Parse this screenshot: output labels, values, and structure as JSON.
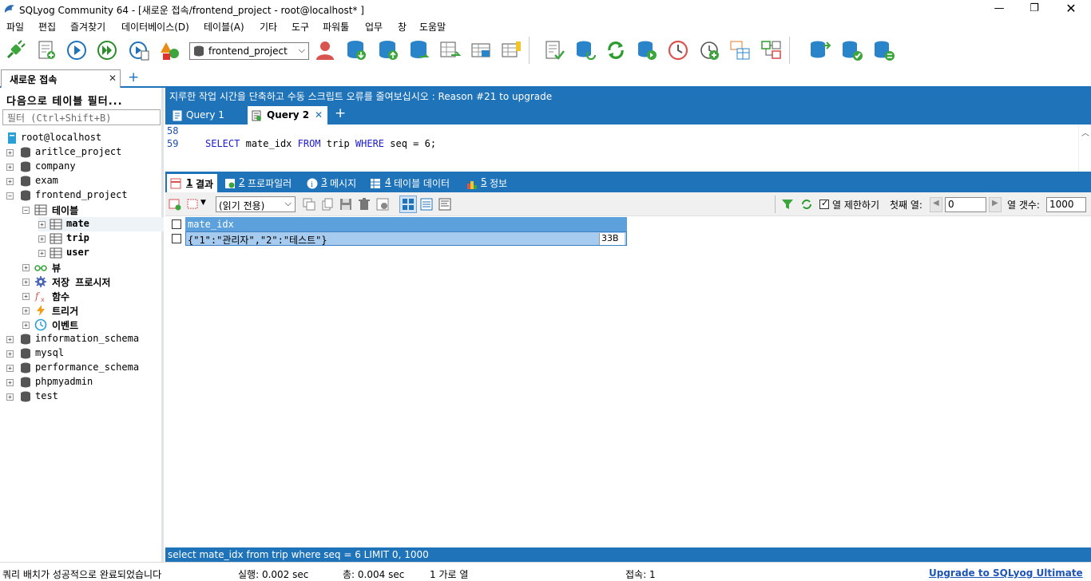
{
  "window": {
    "title": "SQLyog Community 64 - [새로운 접속/frontend_project - root@localhost* ]"
  },
  "menu": [
    "파일",
    "편집",
    "즐겨찾기",
    "데이터베이스(D)",
    "테이블(A)",
    "기타",
    "도구",
    "파워툴",
    "업무",
    "창",
    "도움말"
  ],
  "toolbar": {
    "database": "frontend_project"
  },
  "connection_tab": {
    "label": "새로운 접속",
    "close": "✕",
    "add": "+"
  },
  "object_browser": {
    "filter_title": "다음으로 테이블 필터...",
    "filter_placeholder": "필터 (Ctrl+Shift+B)",
    "root": "root@localhost",
    "databases": {
      "aritlce_project": "aritlce_project",
      "company": "company",
      "exam": "exam",
      "frontend_project": "frontend_project",
      "information_schema": "information_schema",
      "mysql": "mysql",
      "performance_schema": "performance_schema",
      "phpmyadmin": "phpmyadmin",
      "test": "test"
    },
    "folders": {
      "tables": "테이블",
      "views": "뷰",
      "procedures": "저장 프로시저",
      "functions": "함수",
      "triggers": "트리거",
      "events": "이벤트"
    },
    "tables": [
      "mate",
      "trip",
      "user"
    ]
  },
  "upgrade_banner": "지루한 작업 시간을 단축하고 수동 스크립트 오류를 줄여보십시오 : Reason #21 to upgrade",
  "query_tabs": {
    "tab1": "Query 1",
    "tab2": "Query 2",
    "close": "✕",
    "add": "+"
  },
  "editor": {
    "line1_no": "58",
    "line2_no": "59",
    "sql": {
      "select": "SELECT",
      "col": "mate_idx",
      "from": "FROM",
      "table": "trip",
      "where": "WHERE",
      "cond": "seq = 6;"
    }
  },
  "result_tabs": {
    "t1_no": "1",
    "t1": "결과",
    "t2_no": "2",
    "t2": "프로파일러",
    "t3_no": "3",
    "t3": "메시지",
    "t4_no": "4",
    "t4": "테이블 데이터",
    "t5_no": "5",
    "t5": "정보"
  },
  "result_toolbar": {
    "mode": "(읽기 전용)",
    "limit_label": "열 제한하기",
    "first_row_label": "첫째 열:",
    "first_row_value": "0",
    "row_count_label": "열 갯수:",
    "row_count_value": "1000"
  },
  "grid": {
    "column": "mate_idx",
    "row_value": "{\"1\":\"관리자\",\"2\":\"테스트\"}",
    "row_size": "33B"
  },
  "query_status": "select mate_idx from trip where seq = 6 LIMIT 0, 1000",
  "statusbar": {
    "message": "쿼리 배치가 성공적으로 완료되었습니다",
    "exec": "실행: 0.002 sec",
    "total": "총: 0.004 sec",
    "rows": "1 가로 열",
    "connections": "접속: 1",
    "upgrade_link": "Upgrade to SQLyog Ultimate"
  },
  "colors": {
    "accent": "#1e73b9",
    "keyword": "#1c1cd6",
    "selection": "#a6cbee",
    "link": "#1f55b7"
  }
}
